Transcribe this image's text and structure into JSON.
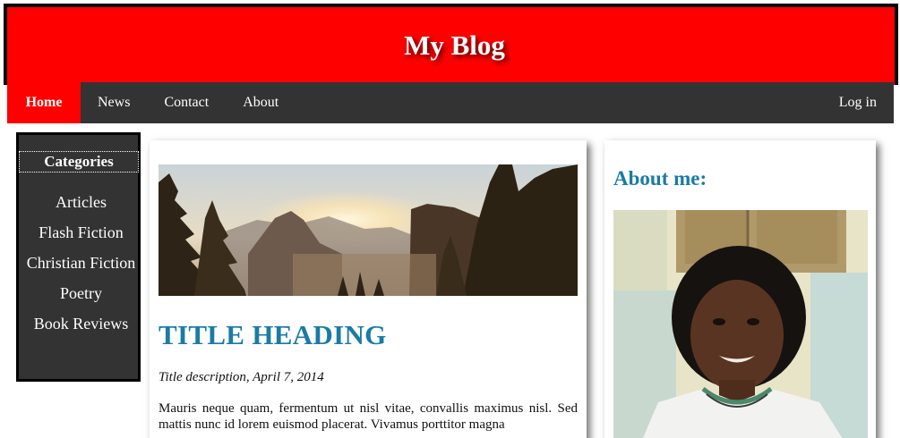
{
  "header": {
    "title": "My Blog"
  },
  "nav": {
    "items": [
      {
        "label": "Home",
        "active": true
      },
      {
        "label": "News"
      },
      {
        "label": "Contact"
      },
      {
        "label": "About"
      }
    ],
    "login_label": "Log in"
  },
  "categories": {
    "title": "Categories",
    "items": [
      "Articles",
      "Flash Fiction",
      "Christian Fiction",
      "Poetry",
      "Book Reviews"
    ]
  },
  "post": {
    "image": "mountain-sunset-photo",
    "heading": "TITLE HEADING",
    "description": "Title description, April 7, 2014",
    "body": "Mauris neque quam, fermentum ut nisl vitae, convallis maximus nisl. Sed mattis nunc id lorem euismod placerat. Vivamus porttitor magna"
  },
  "about": {
    "heading": "About me:",
    "photo": "profile-photo"
  },
  "colors": {
    "header_bg": "#ff0000",
    "nav_bg": "#333333",
    "accent_blue": "#1a7ba6"
  }
}
